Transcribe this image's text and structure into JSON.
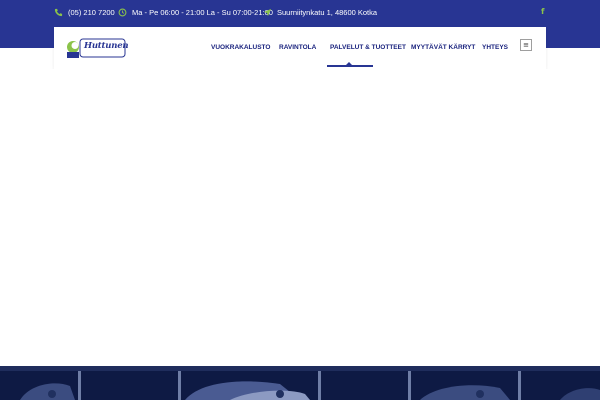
{
  "topbar": {
    "phone": "(05) 210 7200",
    "hours": "Ma - Pe 06:00 - 21:00 La - Su 07:00-21:00",
    "address": "Suurniitynkatu 1, 48600 Kotka",
    "icons": [
      "phone-icon",
      "clock-icon",
      "location-arrow-icon",
      "facebook-icon"
    ],
    "facebook_glyph": "f"
  },
  "header": {
    "logo_text": "Huttunen",
    "nav": [
      "VUOKRAKALUSTO",
      "RAVINTOLA",
      "PALVELUT & TUOTTEET",
      "MYYTÄVÄT KÄRRYT",
      "YHTEYS"
    ],
    "active_nav": "RAVINTOLA",
    "menu_glyph": "≡"
  },
  "colors": {
    "brand_blue": "#283593",
    "accent_green": "#8bc34a",
    "hero_dark": "#0e1a44"
  }
}
